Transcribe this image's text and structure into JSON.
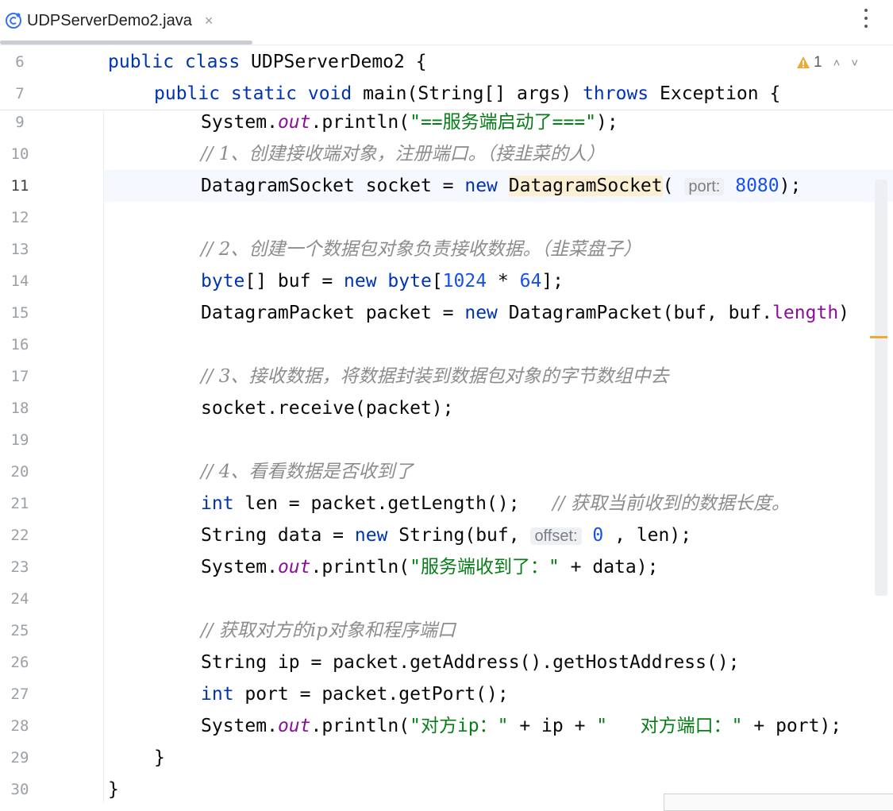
{
  "tab": {
    "filename": "UDPServerDemo2.java",
    "close_glyph": "×",
    "icon": "class-icon"
  },
  "toolbar": {
    "more_icon": "more-vertical-icon"
  },
  "inspections": {
    "warning_count": "1",
    "icon": "warning-triangle-icon",
    "up_icon": "chevron-up-icon",
    "down_icon": "chevron-down-icon"
  },
  "colors": {
    "keyword": "#0033b3",
    "number": "#1750eb",
    "string": "#067d17",
    "field": "#871094",
    "comment": "#8c8c8c",
    "warning": "#f0a830"
  },
  "lines": {
    "l6": {
      "n": "6",
      "t1": "public class ",
      "t2": "UDPServerDemo2 {"
    },
    "l7": {
      "n": "7",
      "t1": "public static void ",
      "t2": "main",
      "t3": "(String[] args) ",
      "t4": "throws",
      "t5": " Exception {"
    },
    "l9": {
      "n": "9",
      "t1": "System.",
      "t2": "out",
      "t3": ".println(",
      "t4": "\"==服务端启动了===\"",
      "t5": ");"
    },
    "l10": {
      "n": "10",
      "t1": "// 1、创建接收端对象，注册端口。（接韭菜的人）"
    },
    "l11": {
      "n": "11",
      "t1": "DatagramSocket socket = ",
      "t2": "new",
      "t3": " ",
      "t4": "DatagramSocket",
      "t5": "( ",
      "hint": "port:",
      "t6": "8080",
      "t7": ");"
    },
    "l12": {
      "n": "12"
    },
    "l13": {
      "n": "13",
      "t1": "// 2、创建一个数据包对象负责接收数据。（韭菜盘子）"
    },
    "l14": {
      "n": "14",
      "t1": "byte",
      "t2": "[] buf = ",
      "t3": "new",
      "t4": " ",
      "t5": "byte",
      "t6": "[",
      "t7": "1024",
      "t8": " * ",
      "t9": "64",
      "t10": "];"
    },
    "l15": {
      "n": "15",
      "t1": "DatagramPacket packet = ",
      "t2": "new",
      "t3": " DatagramPacket(buf, buf.",
      "t4": "length",
      "t5": ")"
    },
    "l16": {
      "n": "16"
    },
    "l17": {
      "n": "17",
      "t1": "// 3、接收数据，将数据封装到数据包对象的字节数组中去"
    },
    "l18": {
      "n": "18",
      "t1": "socket.receive(packet);"
    },
    "l19": {
      "n": "19"
    },
    "l20": {
      "n": "20",
      "t1": "// 4、看看数据是否收到了"
    },
    "l21": {
      "n": "21",
      "t1": "int",
      "t2": " len = packet.getLength();   ",
      "t3": "// 获取当前收到的数据长度。"
    },
    "l22": {
      "n": "22",
      "t1": "String data = ",
      "t2": "new",
      "t3": " String(buf, ",
      "hint": "offset:",
      "t4": "0",
      "t5": " , len);"
    },
    "l23": {
      "n": "23",
      "t1": "System.",
      "t2": "out",
      "t3": ".println(",
      "t4": "\"服务端收到了：\"",
      "t5": " + data);"
    },
    "l24": {
      "n": "24"
    },
    "l25": {
      "n": "25",
      "t1": "// 获取对方的ip对象和程序端口"
    },
    "l26": {
      "n": "26",
      "t1": "String ip = packet.getAddress().getHostAddress();"
    },
    "l27": {
      "n": "27",
      "t1": "int",
      "t2": " port = packet.getPort();"
    },
    "l28": {
      "n": "28",
      "t1": "System.",
      "t2": "out",
      "t3": ".println(",
      "t4": "\"对方ip：\"",
      "t5": " + ip + ",
      "t6": "\"   对方端口：\"",
      "t7": " + port);"
    },
    "l29": {
      "n": "29",
      "t1": "}"
    },
    "l30": {
      "n": "30",
      "t1": "}"
    }
  }
}
